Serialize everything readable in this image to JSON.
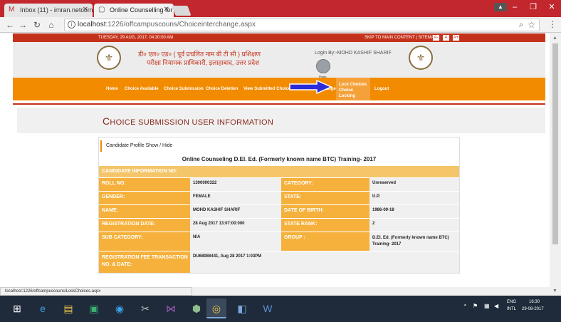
{
  "browser": {
    "tabs": [
      {
        "title": "Inbox (11) - imran.netcom",
        "icon": "gmail-icon"
      },
      {
        "title": "Online Counselling for B",
        "icon": "page-icon"
      }
    ],
    "url_host": "localhost",
    "url_path": ":1226/offcampuscouns/Choiceinterchange.aspx"
  },
  "site": {
    "date": "TUESDAY, 29 AUG, 2017, 04:30:00 AM",
    "top_links": "SKIP TO MAIN CONTENT | SITEMAP",
    "font_buttons": [
      "A-",
      "A",
      "A+"
    ],
    "hindi_line1": "डी० एल० एड० ( पूर्व प्रचलित नाम बी टी सी ) प्रशिक्षण",
    "hindi_line2": "परीक्षा नियामक प्राधिकारी, इलाहाबाद, उत्तर प्रदेश",
    "login_text": "Login By:-MOHD KASHIF SHARIF",
    "avatar_label": "Photo"
  },
  "nav": [
    {
      "label": "Home"
    },
    {
      "label": "Choice Available"
    },
    {
      "label": "Choice Submission"
    },
    {
      "label": "Choice Deletion"
    },
    {
      "label": "View Submitted Choice"
    },
    {
      "label": "Choice Interchange"
    },
    {
      "label": "Lock Choices",
      "sub": "Choice Locking"
    },
    {
      "label": "Logout"
    }
  ],
  "page": {
    "title_cap": "C",
    "title_rest": "HOICE SUBMISSION USER INFORMATION",
    "profile_toggle": "Candidate Profile Show / Hide",
    "info_title": "Online Counseling D.El. Ed. (Formerly known name BTC) Training- 2017",
    "section_head": "CANDIDATE INFORMATION NO:",
    "rows": [
      {
        "l1": "ROLL NO:",
        "v1": "1300000322",
        "l2": "CATEGORY:",
        "v2": "Unreserved"
      },
      {
        "l1": "GENDER:",
        "v1": "FEMALE",
        "l2": "STATE:",
        "v2": "U.P."
      },
      {
        "l1": "NAME:",
        "v1": "MOHD KASHIF SHARIF",
        "l2": "DATE OF BIRTH:",
        "v2": "1986-09-18"
      },
      {
        "l1": "REGISTRATION DATE:",
        "v1": "28 Aug 2017 13:07:00:000",
        "l2": "STATE RANK:",
        "v2": "2"
      },
      {
        "l1": "SUB CATEGORY:",
        "v1": "N/A",
        "l2": "GROUP :",
        "v2": "D.El. Ed. (Formerly known name BTC) Training- 2017"
      }
    ],
    "fee_label": "REGISTRATION FEE TRANSACTION NO. & DATE:",
    "fee_value": "DU68086441, Aug 28 2017 1:03PM"
  },
  "status_url": "localhost:1226/offcampuscouns/LockChoices.aspx",
  "taskbar": {
    "lang": "ENG",
    "intl": "INTL",
    "time": "16:30",
    "date": "29-08-2017"
  }
}
